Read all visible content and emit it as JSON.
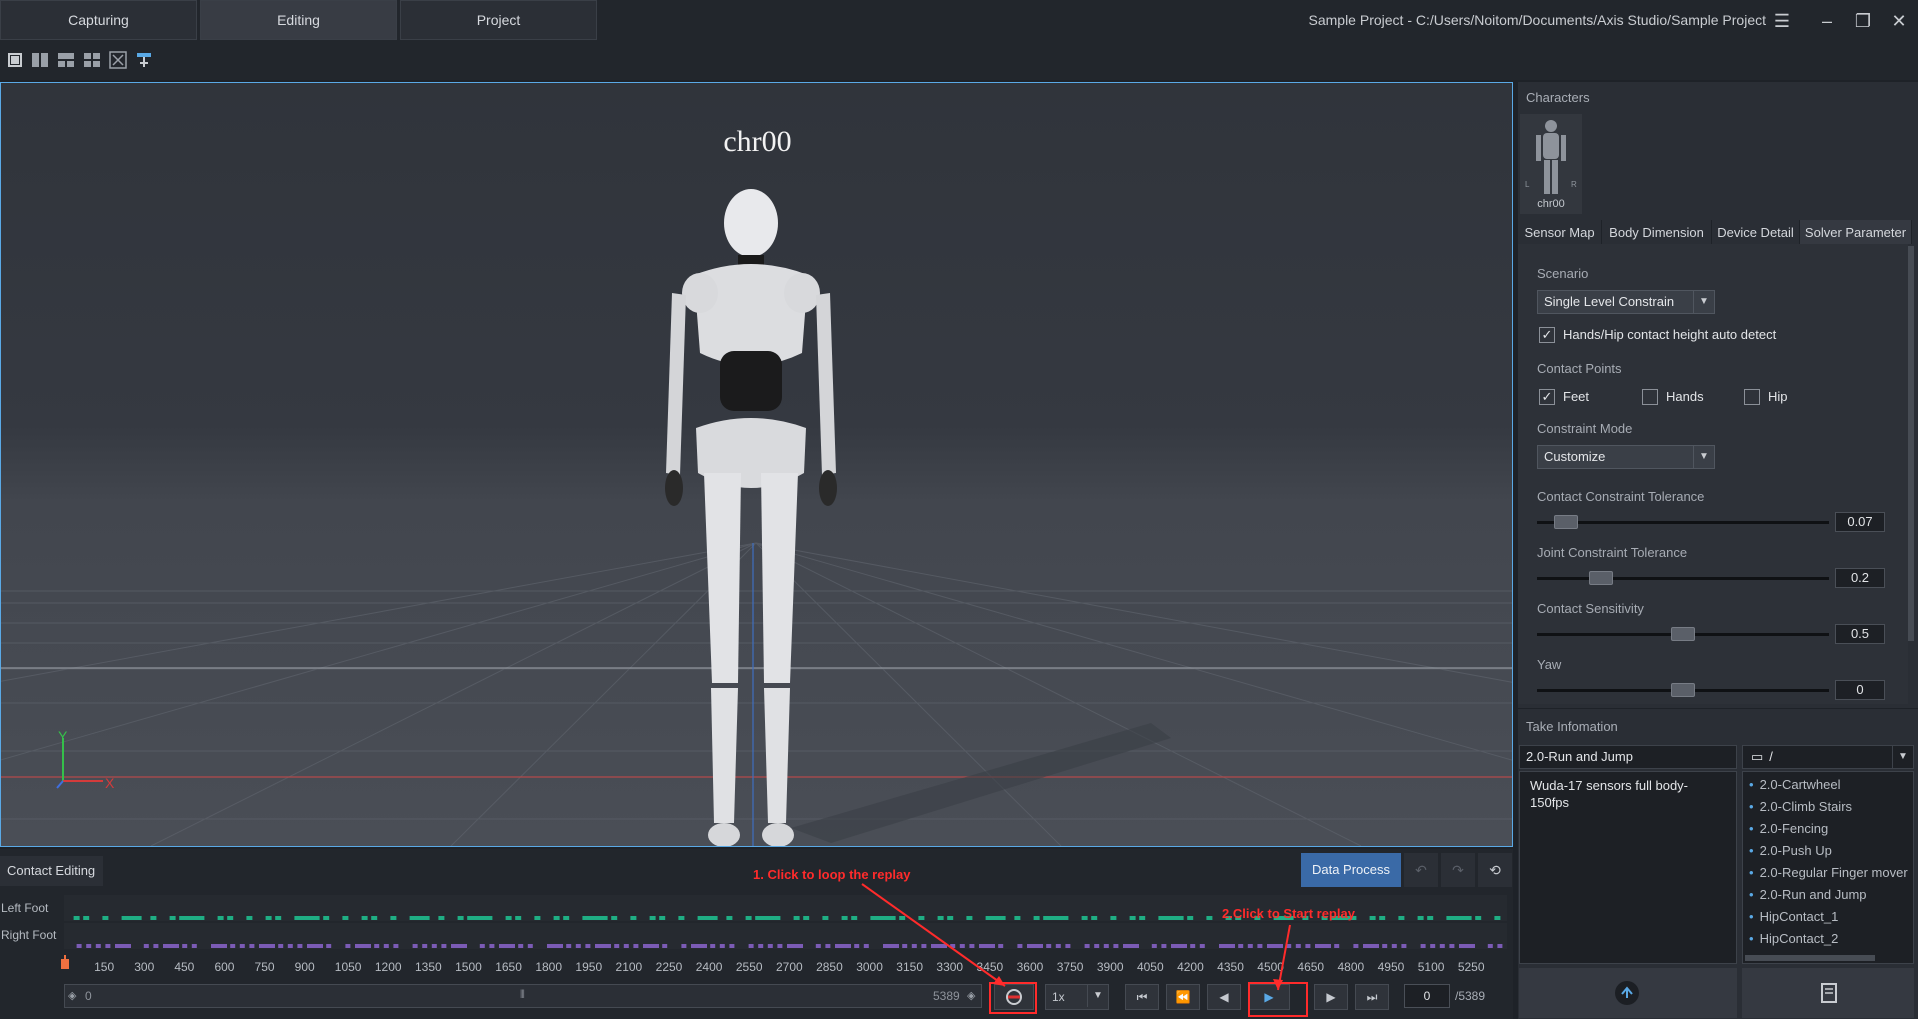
{
  "top_tabs": [
    "Capturing",
    "Editing",
    "Project"
  ],
  "window_title": "Sample Project - C:/Users/Noitom/Documents/Axis Studio/Sample Project",
  "viewport": {
    "character_label": "chr00",
    "axis_y": "Y",
    "axis_x": "X"
  },
  "right_panel": {
    "characters_header": "Characters",
    "character_name": "chr00",
    "figure_left": "L",
    "figure_right": "R",
    "sub_tabs": [
      "Sensor Map",
      "Body Dimension",
      "Device Detail",
      "Solver Parameter"
    ],
    "active_sub_tab": "Solver Parameter",
    "scenario_label": "Scenario",
    "scenario_value": "Single Level Constrain",
    "auto_detect_label": "Hands/Hip contact height auto detect",
    "auto_detect_checked": true,
    "contact_points_label": "Contact Points",
    "contact_points": [
      {
        "label": "Feet",
        "checked": true
      },
      {
        "label": "Hands",
        "checked": false
      },
      {
        "label": "Hip",
        "checked": false
      }
    ],
    "constraint_mode_label": "Constraint Mode",
    "constraint_mode_value": "Customize",
    "sliders": [
      {
        "label": "Contact Constraint Tolerance",
        "value": "0.07",
        "fraction": 0.1
      },
      {
        "label": "Joint Constraint Tolerance",
        "value": "0.2",
        "fraction": 0.22
      },
      {
        "label": "Contact Sensitivity",
        "value": "0.5",
        "fraction": 0.5
      },
      {
        "label": "Yaw",
        "value": "0",
        "fraction": 0.5
      }
    ],
    "take_info_header": "Take Infomation",
    "take_name": "2.0-Run and Jump",
    "take_path": "/",
    "take_description": "Wuda-17 sensors full body-150fps",
    "take_list": [
      "2.0-Cartwheel",
      "2.0-Climb Stairs",
      "2.0-Fencing",
      "2.0-Push Up",
      "2.0-Regular Finger mover",
      "2.0-Run and Jump",
      "HipContact_1",
      "HipContact_2"
    ]
  },
  "bottom": {
    "contact_editing_label": "Contact Editing",
    "data_process_label": "Data Process",
    "left_foot_label": "Left Foot",
    "right_foot_label": "Right Foot",
    "ticks": [
      "150",
      "300",
      "450",
      "600",
      "750",
      "900",
      "1050",
      "1200",
      "1350",
      "1500",
      "1650",
      "1800",
      "1950",
      "2100",
      "2250",
      "2400",
      "2550",
      "2700",
      "2850",
      "3000",
      "3150",
      "3300",
      "3450",
      "3600",
      "3750",
      "3900",
      "4050",
      "4200",
      "4350",
      "4500",
      "4650",
      "4800",
      "4950",
      "5100",
      "5250"
    ],
    "range_start": "0",
    "range_end": "5389",
    "speed": "1x",
    "current_frame": "0",
    "total_frames": "/5389"
  },
  "annotations": {
    "loop": "1. Click to loop the replay",
    "start": "2.Click to Start replay"
  },
  "colors": {
    "accent": "#5aa9e6",
    "left_foot": "#1fae84",
    "right_foot": "#7b5bb5",
    "annotation": "#ff2b2b"
  }
}
